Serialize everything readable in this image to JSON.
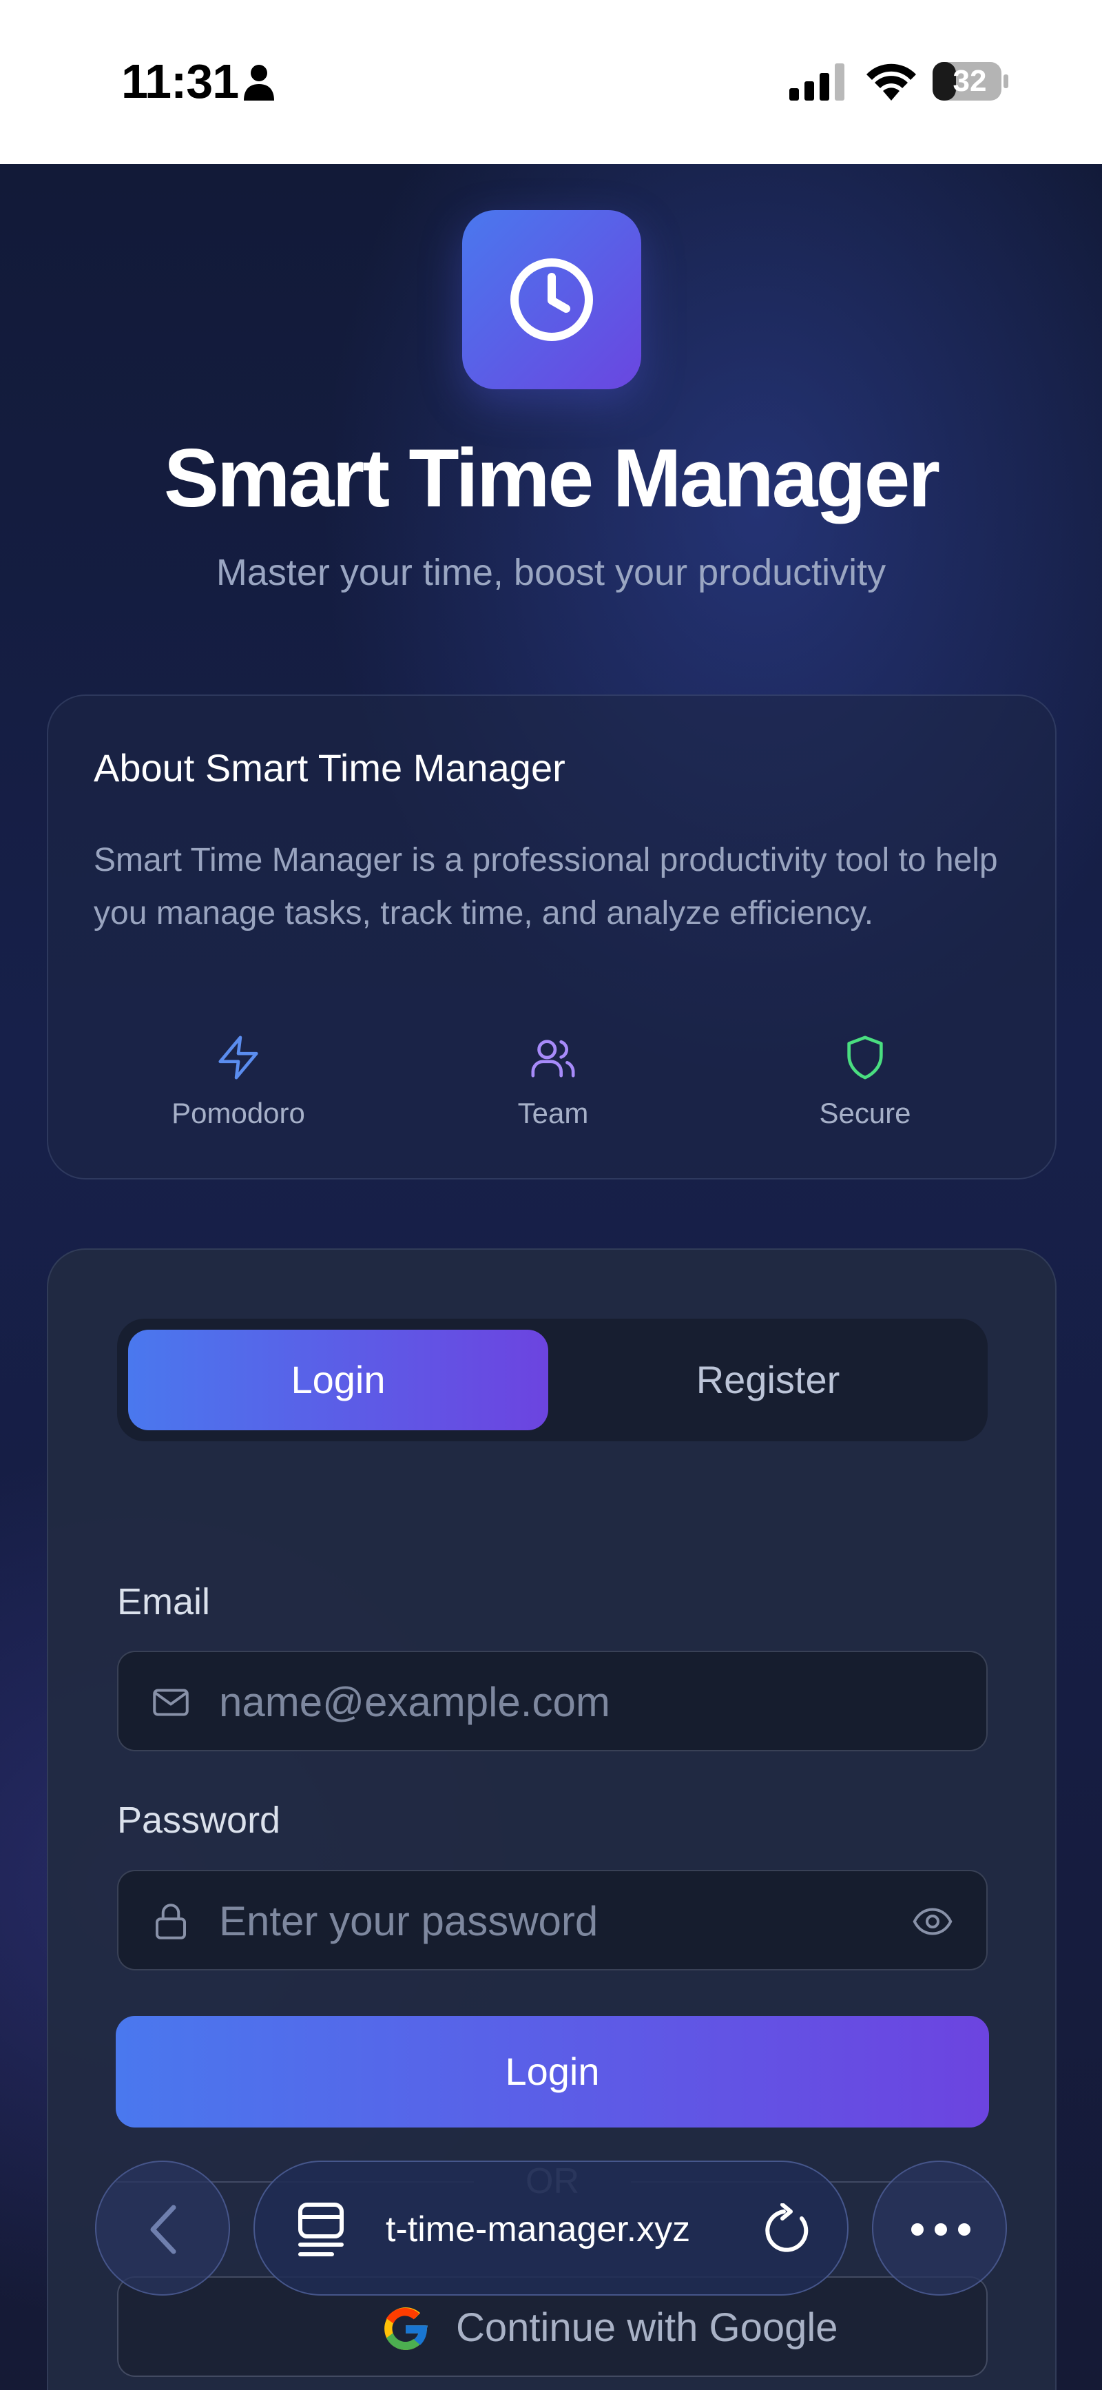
{
  "status_bar": {
    "time": "11:31",
    "battery": "32",
    "icons": [
      "person-icon",
      "signal-icon",
      "wifi-icon",
      "battery-icon"
    ]
  },
  "app": {
    "title": "Smart Time Manager",
    "subtitle": "Master your time, boost your productivity",
    "logo_icon": "clock-icon"
  },
  "about": {
    "title": "About Smart Time Manager",
    "description": "Smart Time Manager is a professional productivity tool to help you manage tasks, track time, and analyze efficiency.",
    "features": [
      {
        "label": "Pomodoro",
        "icon": "lightning-icon",
        "color": "#5b8def"
      },
      {
        "label": "Team",
        "icon": "users-icon",
        "color": "#a78bfa"
      },
      {
        "label": "Secure",
        "icon": "shield-icon",
        "color": "#4ade80"
      }
    ]
  },
  "auth": {
    "tabs": [
      {
        "label": "Login",
        "active": true
      },
      {
        "label": "Register",
        "active": false
      }
    ],
    "email_label": "Email",
    "email_placeholder": "name@example.com",
    "password_label": "Password",
    "password_placeholder": "Enter your password",
    "login_button": "Login",
    "divider_text": "OR",
    "google_button": "Continue with Google"
  },
  "browser": {
    "url": "t-time-manager.xyz"
  },
  "colors": {
    "accent_start": "#4a78ee",
    "accent_end": "#6c44e0",
    "background": "#151d40"
  }
}
